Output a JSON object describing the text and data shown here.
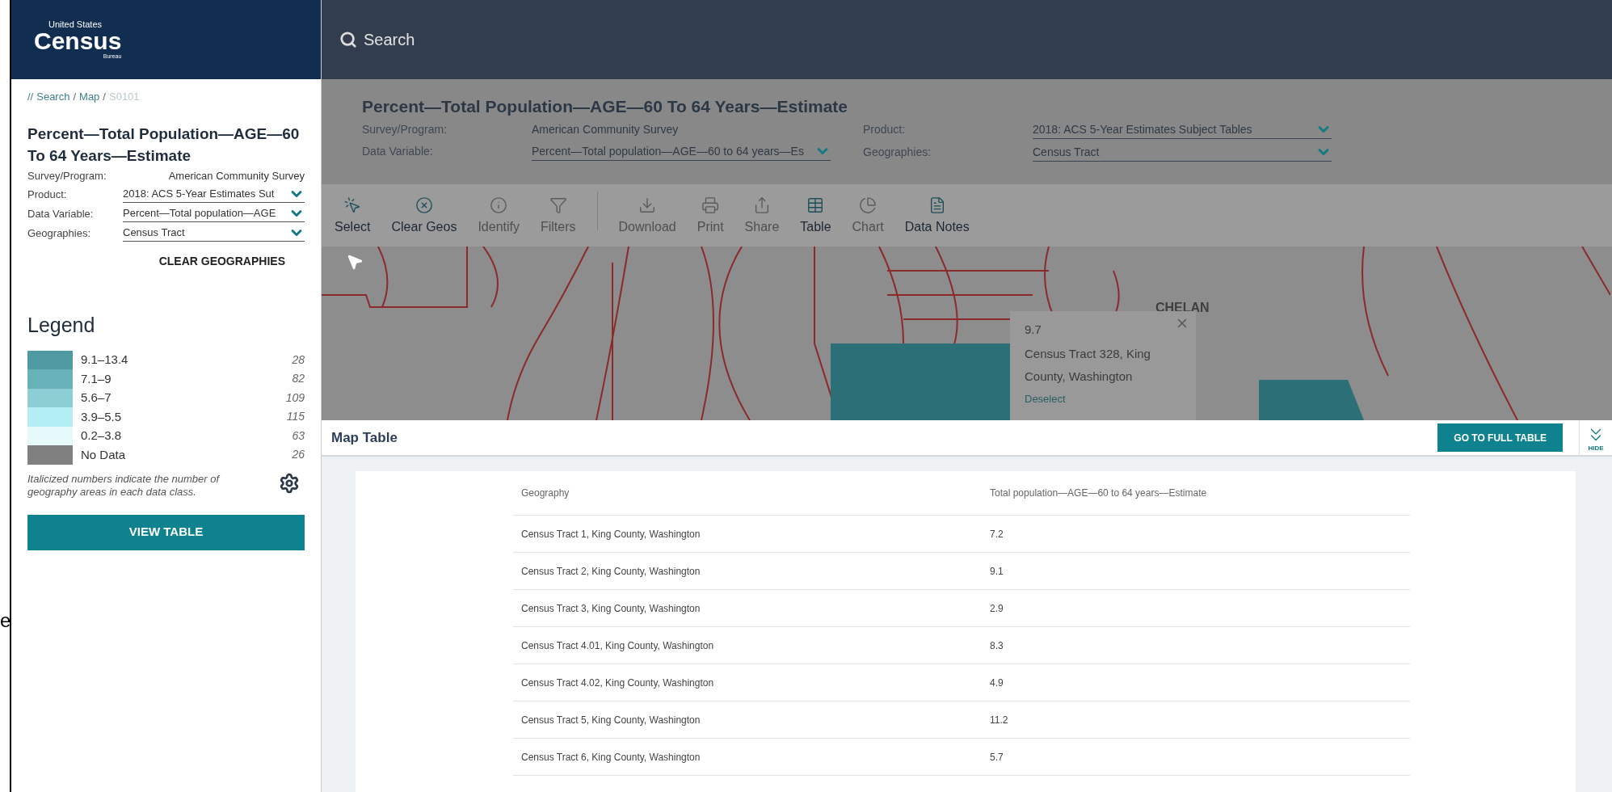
{
  "slide_fragment": "e",
  "sidebar": {
    "logo": {
      "top": "United States",
      "main": "Census",
      "bottom": "Bureau"
    },
    "breadcrumb": {
      "prefix": "//",
      "separator": "/",
      "items": [
        {
          "label": "Search",
          "selected": false
        },
        {
          "label": "Map",
          "selected": false
        },
        {
          "label": "S0101",
          "selected": true
        }
      ]
    },
    "title": "Percent—Total Population—AGE—60 To 64 Years—Estimate",
    "fields": [
      {
        "label": "Survey/Program:",
        "value": "American Community Survey",
        "kind": "text"
      },
      {
        "label": "Product:",
        "value": "2018: ACS 5-Year Estimates Sut",
        "kind": "dropdown"
      },
      {
        "label": "Data Variable:",
        "value": "Percent—Total population—AGE",
        "kind": "dropdown"
      },
      {
        "label": "Geographies:",
        "value": "Census Tract",
        "kind": "dropdown"
      }
    ],
    "clear_button": "CLEAR GEOGRAPHIES",
    "legend": {
      "title": "Legend",
      "classes": [
        {
          "range": "9.1–13.4",
          "count": "28",
          "color": "#4f9aa2"
        },
        {
          "range": "7.1–9",
          "count": "82",
          "color": "#69b1b8"
        },
        {
          "range": "5.6–7",
          "count": "109",
          "color": "#8dcdd4"
        },
        {
          "range": "3.9–5.5",
          "count": "115",
          "color": "#b3eef5"
        },
        {
          "range": "0.2–3.8",
          "count": "63",
          "color": "#e6f9fb"
        },
        {
          "range": "No Data",
          "count": "26",
          "color": "#808080"
        }
      ],
      "note": "Italicized numbers indicate the number of geography areas in each data class."
    },
    "view_table_button": "VIEW TABLE"
  },
  "search": {
    "placeholder": "Search"
  },
  "header": {
    "title": "Percent—Total Population—AGE—60 To 64 Years—Estimate",
    "left_fields": [
      {
        "label": "Survey/Program:",
        "value": "American Community Survey",
        "kind": "text"
      },
      {
        "label": "Data Variable:",
        "value": "Percent—Total population—AGE—60 to 64 years—Es",
        "kind": "dropdown"
      }
    ],
    "right_fields": [
      {
        "label": "Product:",
        "value": "2018: ACS 5-Year Estimates Subject Tables",
        "kind": "dropdown"
      },
      {
        "label": "Geographies:",
        "value": "Census Tract",
        "kind": "dropdown"
      }
    ]
  },
  "toolbar": [
    {
      "label": "Select",
      "disabled": false,
      "divider_before": false
    },
    {
      "label": "Clear Geos",
      "disabled": false,
      "divider_before": false
    },
    {
      "label": "Identify",
      "disabled": true,
      "divider_before": false
    },
    {
      "label": "Filters",
      "disabled": true,
      "divider_before": false
    },
    {
      "label": "Download",
      "disabled": true,
      "divider_before": true
    },
    {
      "label": "Print",
      "disabled": true,
      "divider_before": false
    },
    {
      "label": "Share",
      "disabled": true,
      "divider_before": false
    },
    {
      "label": "Table",
      "disabled": false,
      "divider_before": false
    },
    {
      "label": "Chart",
      "disabled": true,
      "divider_before": false
    },
    {
      "label": "Data Notes",
      "disabled": false,
      "divider_before": false
    }
  ],
  "map": {
    "place_label": "CHELAN",
    "popup": {
      "value": "9.7",
      "name": "Census Tract 328, King County, Washington",
      "action": "Deselect"
    }
  },
  "map_table": {
    "title": "Map Table",
    "go_button": "GO TO FULL TABLE",
    "hide_label": "HIDE",
    "columns": [
      "Geography",
      "Total population—AGE—60 to 64 years—Estimate"
    ],
    "rows": [
      [
        "Census Tract 1, King County, Washington",
        "7.2"
      ],
      [
        "Census Tract 2, King County, Washington",
        "9.1"
      ],
      [
        "Census Tract 3, King County, Washington",
        "2.9"
      ],
      [
        "Census Tract 4.01, King County, Washington",
        "8.3"
      ],
      [
        "Census Tract 4.02, King County, Washington",
        "4.9"
      ],
      [
        "Census Tract 5, King County, Washington",
        "11.2"
      ],
      [
        "Census Tract 6, King County, Washington",
        "5.7"
      ]
    ]
  }
}
